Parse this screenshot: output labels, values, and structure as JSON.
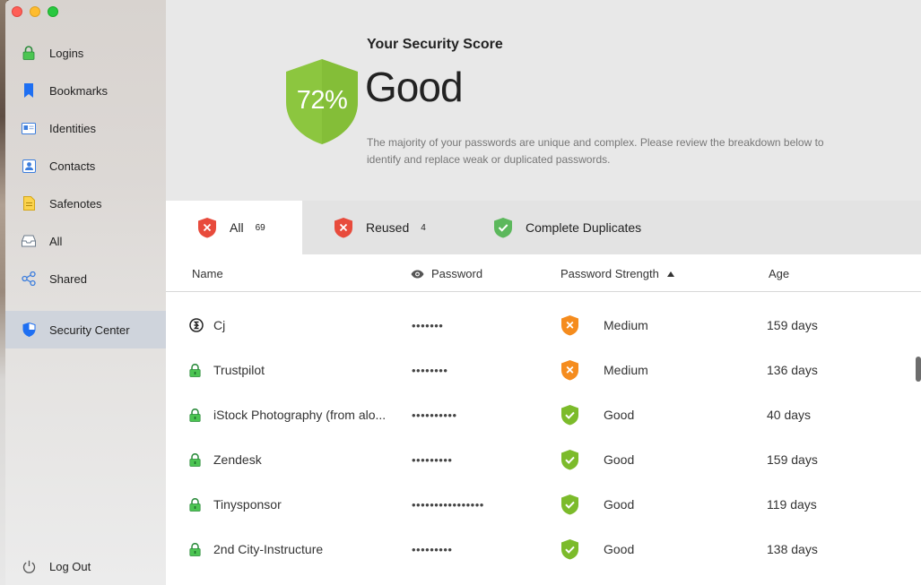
{
  "sidebar": {
    "items": [
      {
        "label": "Logins",
        "icon": "lock-icon"
      },
      {
        "label": "Bookmarks",
        "icon": "bookmark-icon"
      },
      {
        "label": "Identities",
        "icon": "id-card-icon"
      },
      {
        "label": "Contacts",
        "icon": "contact-icon"
      },
      {
        "label": "Safenotes",
        "icon": "note-icon"
      },
      {
        "label": "All",
        "icon": "inbox-icon"
      },
      {
        "label": "Shared",
        "icon": "share-icon"
      },
      {
        "label": "Security Center",
        "icon": "shield-icon",
        "active": true
      }
    ],
    "logout": "Log Out"
  },
  "score": {
    "title": "Your Security Score",
    "percent": "72%",
    "rating": "Good",
    "description": "The majority of your passwords are unique and complex. Please review the breakdown below to identify and replace weak or duplicated passwords."
  },
  "tabs": [
    {
      "label": "All",
      "count": "69",
      "status": "bad"
    },
    {
      "label": "Reused",
      "count": "4",
      "status": "bad"
    },
    {
      "label": "Complete Duplicates",
      "count": "",
      "status": "good"
    }
  ],
  "columns": {
    "name": "Name",
    "password": "Password",
    "strength": "Password Strength",
    "age": "Age"
  },
  "rows": [
    {
      "icon": "site-logo-icon",
      "name": "Cj",
      "password": "•••••••",
      "strength": "Medium",
      "level": "medium",
      "age": "159 days"
    },
    {
      "icon": "lock-icon",
      "name": "Trustpilot",
      "password": "••••••••",
      "strength": "Medium",
      "level": "medium",
      "age": "136 days"
    },
    {
      "icon": "lock-icon",
      "name": "iStock Photography (from alo...",
      "password": "••••••••••",
      "strength": "Good",
      "level": "good",
      "age": "40 days"
    },
    {
      "icon": "lock-icon",
      "name": "Zendesk",
      "password": "•••••••••",
      "strength": "Good",
      "level": "good",
      "age": "159 days"
    },
    {
      "icon": "lock-icon",
      "name": "Tinysponsor",
      "password": "••••••••••••••••",
      "strength": "Good",
      "level": "good",
      "age": "119 days"
    },
    {
      "icon": "lock-icon",
      "name": "2nd City-Instructure",
      "password": "•••••••••",
      "strength": "Good",
      "level": "good",
      "age": "138 days"
    }
  ],
  "colors": {
    "good": "#7cbb2b",
    "medium": "#f58c1e",
    "bad": "#e84b3c",
    "shield_big": "#8cc63f"
  }
}
